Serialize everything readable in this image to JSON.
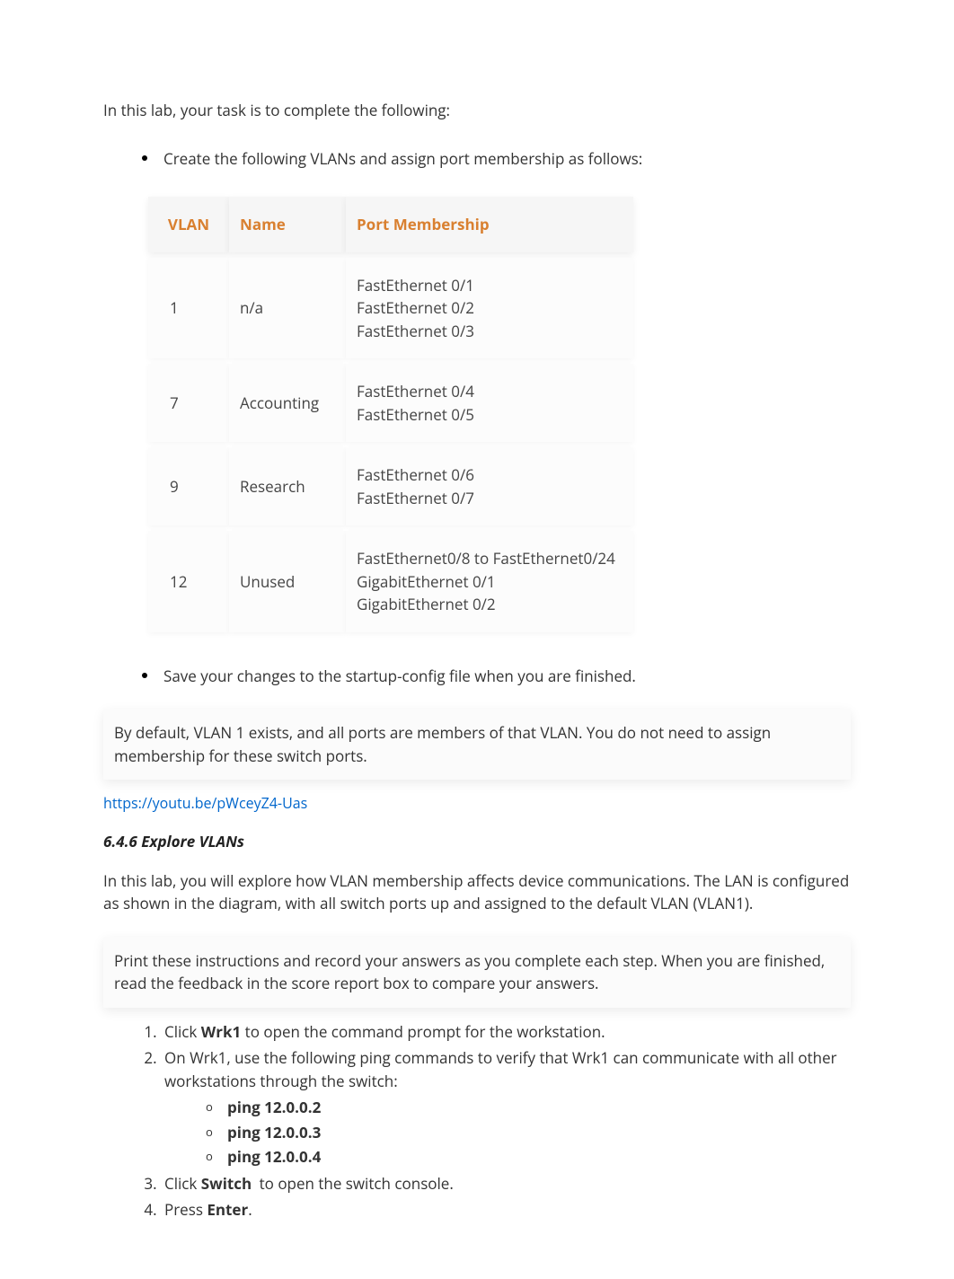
{
  "intro": "In this lab, your task is to complete the following:",
  "bullet1": "Create the following VLANs and assign port membership as follows:",
  "table": {
    "headers": {
      "vlan": "VLAN",
      "name": "Name",
      "port": "Port Membership"
    },
    "rows": [
      {
        "vlan": "1",
        "name": "n/a",
        "ports": [
          "FastEthernet 0/1",
          "FastEthernet 0/2",
          "FastEthernet 0/3"
        ]
      },
      {
        "vlan": "7",
        "name": "Accounting",
        "ports": [
          "FastEthernet 0/4",
          "FastEthernet 0/5"
        ]
      },
      {
        "vlan": "9",
        "name": "Research",
        "ports": [
          "FastEthernet 0/6",
          "FastEthernet 0/7"
        ]
      },
      {
        "vlan": "12",
        "name": "Unused",
        "ports": [
          "FastEthernet0/8 to FastEthernet0/24",
          "GigabitEthernet 0/1",
          "GigabitEthernet 0/2"
        ]
      }
    ]
  },
  "bullet2": "Save your changes to the startup-config file when you are finished.",
  "note_block": "By default, VLAN 1 exists, and all ports are members of that VLAN. You do not need to assign membership for these switch ports.",
  "link_text": "https://youtu.be/pWceyZ4-Uas",
  "section_heading": "6.4.6 Explore VLANs",
  "para1": "In this lab, you will explore how VLAN membership affects device communications. The LAN is configured as shown in the diagram, with all switch ports up and assigned to the default VLAN (VLAN1).",
  "instructions_block": "Print these instructions and record your answers as you complete each step. When you are finished, read the feedback in the score report box to compare your answers.",
  "steps": {
    "s1_pre": "Click ",
    "s1_bold": "Wrk1",
    "s1_post": " to open the command prompt for the workstation.",
    "s2": "On Wrk1, use the following ping commands to verify that Wrk1 can communicate with all other workstations through the switch:",
    "s2_sub": [
      "ping 12.0.0.2",
      "ping 12.0.0.3",
      "ping 12.0.0.4"
    ],
    "s3_pre": "Click ",
    "s3_bold": "Switch",
    "s3_post": " to open the switch console.",
    "s4_pre": "Press ",
    "s4_bold": "Enter",
    "s4_post": "."
  }
}
